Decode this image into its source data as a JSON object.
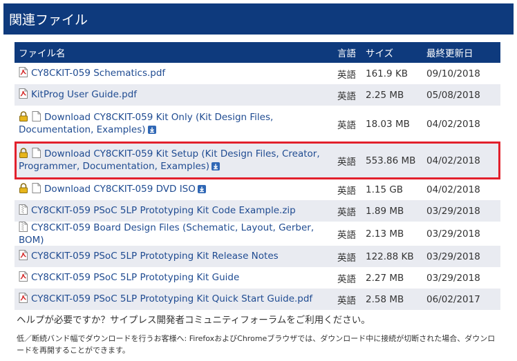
{
  "header": {
    "title": "関連ファイル"
  },
  "table": {
    "columns": [
      "ファイル名",
      "言語",
      "サイズ",
      "最終更新日"
    ],
    "rows": [
      {
        "name": "CY8CKIT-059 Schematics.pdf",
        "lang": "英語",
        "size": "161.9 KB",
        "date": "09/10/2018",
        "icon": "pdf-icon",
        "lock": false,
        "download": false,
        "lines": 1
      },
      {
        "name": "KitProg User Guide.pdf",
        "lang": "英語",
        "size": "2.25 MB",
        "date": "05/08/2018",
        "icon": "pdf-icon",
        "lock": false,
        "download": false,
        "lines": 1
      },
      {
        "name": "Download CY8CKIT-059 Kit Only (Kit Design Files, Documentation, Examples)",
        "lang": "英語",
        "size": "18.03 MB",
        "date": "04/02/2018",
        "icon": "document-icon",
        "lock": true,
        "download": true,
        "lines": 2
      },
      {
        "name": "Download CY8CKIT-059 Kit Setup (Kit Design Files, Creator, Programmer, Documentation, Examples)",
        "lang": "英語",
        "size": "553.86 MB",
        "date": "04/02/2018",
        "icon": "document-icon",
        "lock": true,
        "download": true,
        "lines": 2
      },
      {
        "name": "Download CY8CKIT-059 DVD ISO",
        "lang": "英語",
        "size": "1.15 GB",
        "date": "04/02/2018",
        "icon": "document-icon",
        "lock": true,
        "download": true,
        "lines": 1
      },
      {
        "name": "CY8CKIT-059 PSoC 5LP Prototyping Kit Code Example.zip",
        "lang": "英語",
        "size": "1.89 MB",
        "date": "03/29/2018",
        "icon": "zip-icon",
        "lock": false,
        "download": false,
        "lines": 1
      },
      {
        "name": "CY8CKIT-059 Board Design Files (Schematic, Layout, Gerber, BOM)",
        "lang": "英語",
        "size": "2.13 MB",
        "date": "03/29/2018",
        "icon": "zip-icon",
        "lock": false,
        "download": false,
        "lines": 1
      },
      {
        "name": "CY8CKIT-059 PSoC 5LP Prototyping Kit Release Notes",
        "lang": "英語",
        "size": "122.88 KB",
        "date": "03/29/2018",
        "icon": "pdf-icon",
        "lock": false,
        "download": false,
        "lines": 1
      },
      {
        "name": "CY8CKIT-059 PSoC 5LP Prototyping Kit Guide",
        "lang": "英語",
        "size": "2.27 MB",
        "date": "03/29/2018",
        "icon": "pdf-icon",
        "lock": false,
        "download": false,
        "lines": 1
      },
      {
        "name": "CY8CKIT-059 PSoC 5LP Prototyping Kit Quick Start Guide.pdf",
        "lang": "英語",
        "size": "2.58 MB",
        "date": "06/02/2017",
        "icon": "pdf-icon",
        "lock": false,
        "download": false,
        "lines": 1
      }
    ]
  },
  "help": {
    "text": "ヘルプが必要ですか？サイプレス開発者コミュニティフォーラムをご利用ください。"
  },
  "note": {
    "text": "低／断続バンド幅でダウンロードを行うお客様へ: FirefoxおよびChromeブラウザでは、ダウンロード中に接続が切断された場合、ダウンロードを再開することができます。"
  },
  "colors": {
    "header_bg": "#0e3a7d",
    "link": "#1f4b91",
    "stripe": "#e9ebf1",
    "highlight": "#e2202c"
  }
}
